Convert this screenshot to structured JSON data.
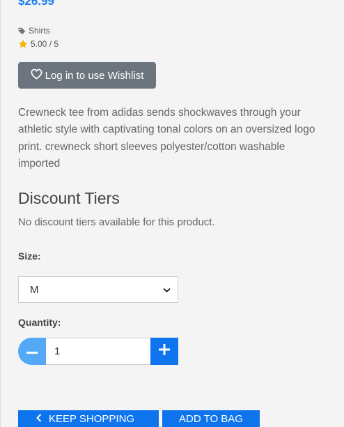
{
  "product": {
    "price": "$26.99",
    "category": "Shirts",
    "rating": "5.00 / 5",
    "wishlist_label": "Log in to use Wishlist",
    "description": "Crewneck tee from adidas sends shockwaves through your athletic style with captivating tonal colors on an oversized logo print. crewneck short sleeves polyester/cotton washable imported"
  },
  "discount": {
    "title": "Discount Tiers",
    "note": "No discount tiers available for this product."
  },
  "options": {
    "size_label": "Size:",
    "size_value": "M",
    "quantity_label": "Quantity:",
    "quantity_value": "1"
  },
  "actions": {
    "keep_shopping": "KEEP SHOPPING",
    "add_to_bag": "ADD TO BAG"
  },
  "colors": {
    "accent": "#0d74ee",
    "price": "#1a7cf5",
    "wishlist_button": "#6c757d",
    "minus_button": "#53a8f7",
    "star": "#f5b301"
  },
  "icons": {
    "category": "tag-icon",
    "rating": "star-icon",
    "wishlist": "heart-icon",
    "size_dropdown": "chevron-down-icon",
    "decrease": "minus-icon",
    "increase": "plus-icon",
    "back": "chevron-left-icon"
  }
}
